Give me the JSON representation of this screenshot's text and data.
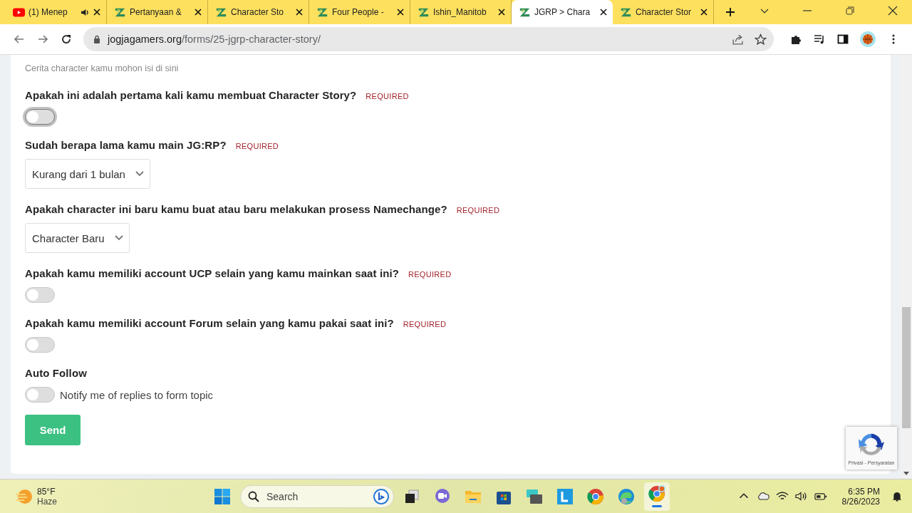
{
  "tabs": [
    {
      "kind": "video",
      "title": "(1) Menep",
      "audio": true,
      "selected": false
    },
    {
      "kind": "forum",
      "title": "Pertanyaan &",
      "audio": false,
      "selected": false
    },
    {
      "kind": "forum",
      "title": "Character Sto",
      "audio": false,
      "selected": false
    },
    {
      "kind": "forum",
      "title": "Four People -",
      "audio": false,
      "selected": false
    },
    {
      "kind": "forum",
      "title": "Ishin_Manitob",
      "audio": false,
      "selected": false
    },
    {
      "kind": "forum",
      "title": "JGRP > Chara",
      "audio": false,
      "selected": true
    },
    {
      "kind": "forum",
      "title": "Character Stor",
      "audio": false,
      "selected": false
    }
  ],
  "address": {
    "host": "jogjagamers.org",
    "path": "/forms/25-jgrp-character-story/"
  },
  "form": {
    "hint": "Cerita character kamu mohon isi di sini",
    "fields": [
      {
        "kind": "toggle",
        "question": "Apakah ini adalah pertama kali kamu membuat Character Story?",
        "required": "REQUIRED",
        "on": false,
        "focused": true
      },
      {
        "kind": "select",
        "question": "Sudah berapa lama kamu main JG:RP?",
        "required": "REQUIRED",
        "value": "Kurang dari 1 bulan"
      },
      {
        "kind": "select",
        "question": "Apakah character ini baru kamu buat atau baru melakukan prosess Namechange?",
        "required": "REQUIRED",
        "value": "Character Baru"
      },
      {
        "kind": "toggle",
        "question": "Apakah kamu memiliki account UCP selain yang kamu mainkan saat ini?",
        "required": "REQUIRED",
        "on": false,
        "focused": false
      },
      {
        "kind": "toggle",
        "question": "Apakah kamu memiliki account Forum selain yang kamu pakai saat ini?",
        "required": "REQUIRED",
        "on": false,
        "focused": false
      }
    ],
    "auto_follow": {
      "heading": "Auto Follow",
      "label": "Notify me of replies to form topic",
      "on": false
    },
    "submit": "Send"
  },
  "recaptcha": {
    "links": "Privasi - Persyaratan"
  },
  "taskbar": {
    "temperature": "85°F",
    "weather": "Haze",
    "search_placeholder": "Search",
    "time": "6:35 PM",
    "date": "8/26/2023"
  }
}
